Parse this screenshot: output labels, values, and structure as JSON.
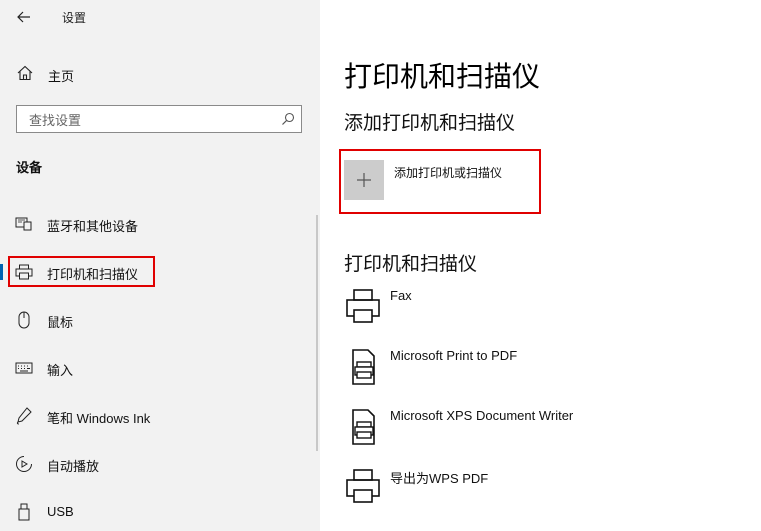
{
  "window": {
    "title": "设置"
  },
  "sidebar": {
    "home_label": "主页",
    "search_placeholder": "查找设置",
    "section_title": "设备",
    "items": [
      {
        "label": "蓝牙和其他设备",
        "icon": "bluetooth-devices-icon",
        "active": false
      },
      {
        "label": "打印机和扫描仪",
        "icon": "printer-icon",
        "active": true
      },
      {
        "label": "鼠标",
        "icon": "mouse-icon",
        "active": false
      },
      {
        "label": "输入",
        "icon": "keyboard-icon",
        "active": false
      },
      {
        "label": "笔和 Windows Ink",
        "icon": "pen-icon",
        "active": false
      },
      {
        "label": "自动播放",
        "icon": "autoplay-icon",
        "active": false
      },
      {
        "label": "USB",
        "icon": "usb-icon",
        "active": false
      }
    ]
  },
  "main": {
    "title": "打印机和扫描仪",
    "add_section_title": "添加打印机和扫描仪",
    "add_button_label": "添加打印机或扫描仪",
    "list_title": "打印机和扫描仪",
    "printers": [
      {
        "name": "Fax",
        "icon": "fax-printer-icon"
      },
      {
        "name": "Microsoft Print to PDF",
        "icon": "pdf-printer-icon"
      },
      {
        "name": "Microsoft XPS Document Writer",
        "icon": "xps-printer-icon"
      },
      {
        "name": "导出为WPS PDF",
        "icon": "wps-pdf-printer-icon"
      }
    ]
  },
  "colors": {
    "accent": "#0063b1",
    "highlight_border": "#e00000",
    "sidebar_bg": "#f2f2f2",
    "add_tile_bg": "#cccccc"
  }
}
